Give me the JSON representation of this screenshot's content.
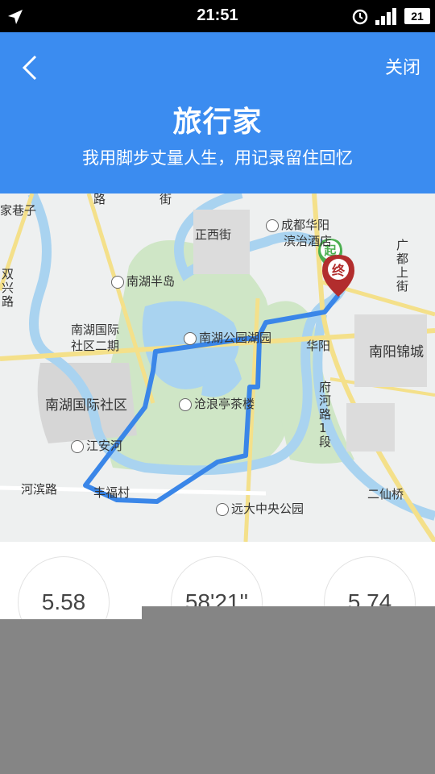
{
  "status_bar": {
    "time": "21:51",
    "battery": "21"
  },
  "header": {
    "close_label": "关闭",
    "title": "旅行家",
    "subtitle": "我用脚步丈量人生，用记录留住回忆"
  },
  "map": {
    "start_marker": "起",
    "end_marker": "终",
    "labels": {
      "jiaxiangzi": "家巷子",
      "lu": "路",
      "jie1": "街",
      "zhengxijie": "正西街",
      "chengdu": "成都华阳",
      "binzhi": "滨治酒店",
      "nanhubandao": "南湖半岛",
      "nanhuguoji": "南湖国际",
      "shequerqi": "社区二期",
      "nanhugongyuan": "南湖公园湖园",
      "huayang": "华阳",
      "nanyangjincheng": "南阳锦城",
      "nanhuguojishequ": "南湖国际社区",
      "canglang": "沧浪亭茶楼",
      "jiangan": "江安河",
      "hebinlu": "河滨路",
      "fengfucun": "丰福村",
      "yuanda": "远大中央公园",
      "erxianqiao": "二仙桥",
      "shuangxing": "双兴路",
      "fuhelu": "府河路1段",
      "guangdushang": "广都上街"
    }
  },
  "stats": {
    "distance": "5.58",
    "duration": "58'21''",
    "speed": "5.74"
  }
}
